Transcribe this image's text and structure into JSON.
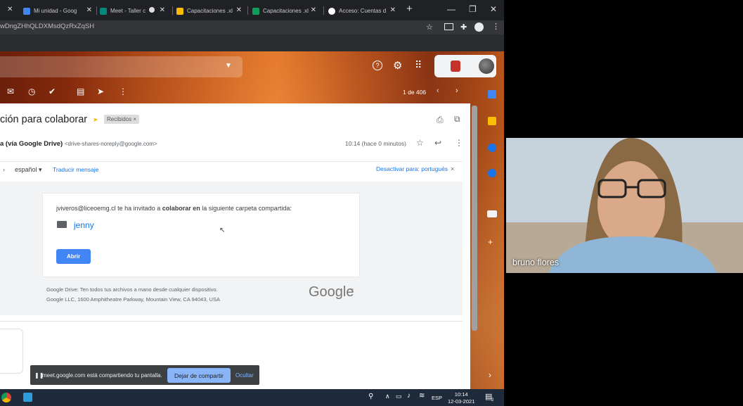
{
  "browser": {
    "tabs": [
      {
        "label": "Mi unidad - Goog",
        "icon": "google-drive-icon",
        "color": "#4285f4"
      },
      {
        "label": "Meet - Taller c",
        "icon": "google-meet-icon",
        "color": "#00897b"
      },
      {
        "label": "Capacitaciones .xl",
        "icon": "google-drive-icon",
        "color": "#fbbc04"
      },
      {
        "label": "Capacitaciones .xl",
        "icon": "google-sheets-icon",
        "color": "#0f9d58"
      },
      {
        "label": "Acceso: Cuentas d",
        "icon": "google-icon",
        "color": "#ffffff"
      }
    ],
    "new_tab": "+",
    "url": "wDngZHhQLDXMsdQzRxZqSH"
  },
  "gmail": {
    "pager": "1 de 406",
    "subject": "ción para colaborar",
    "label_chip": "Recibidos ×",
    "sender_name": "a (vía Google Drive)",
    "sender_email": "<drive-shares-noreply@google.com>",
    "time": "10:14 (hace 0 minutos)",
    "language": "español",
    "translate_link": "Traducir mensaje",
    "disable_translate": "Desactivar para: portugués",
    "invite_prefix": "jviveros@liceoemg.cl te ha invitado a ",
    "invite_bold": "colaborar en",
    "invite_suffix": " la siguiente carpeta compartida:",
    "folder_name": "jenny",
    "open_button": "Abrir",
    "footer_line1": "Google Drive: Ten todos tus archivos a mano desde cualquier dispositivo.",
    "footer_line2": "Google LLC, 1600 Amphitheatre Parkway, Mountain View, CA 94043, USA",
    "footer_logo": "Google"
  },
  "share_bar": {
    "message": "meet.google.com está compartiendo tu pantalla.",
    "stop_button": "Dejar de compartir",
    "hide_button": "Ocultar"
  },
  "taskbar": {
    "language": "ESP",
    "time": "10:14",
    "date": "12-03-2021",
    "notifications": "2"
  },
  "meet": {
    "participant_name": "bruno flores"
  }
}
